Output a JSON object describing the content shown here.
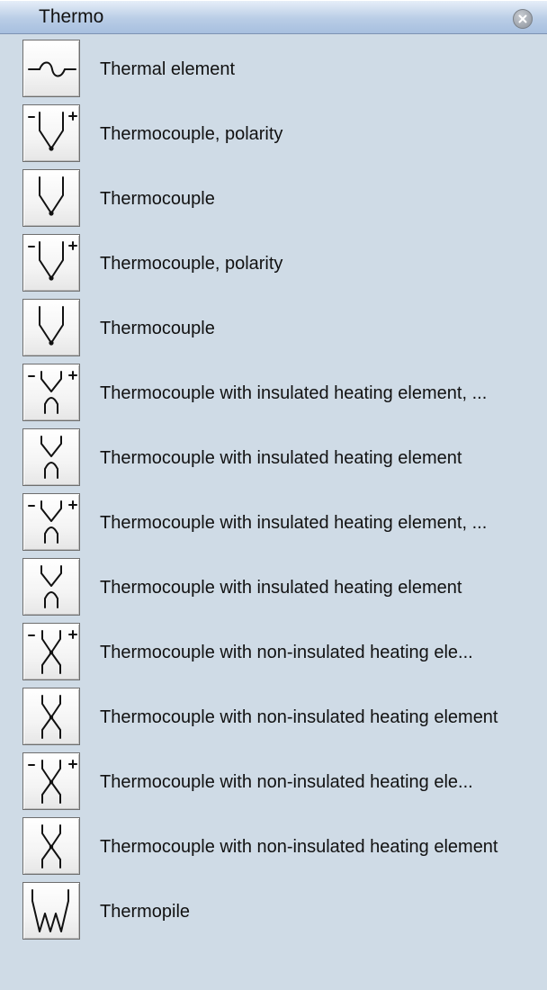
{
  "panel": {
    "title": "Thermo"
  },
  "items": [
    {
      "label": "Thermal element",
      "icon": "thermal-element-icon",
      "type": "thermal"
    },
    {
      "label": "Thermocouple, polarity",
      "icon": "thermocouple-polarity-icon",
      "type": "tc-pol-a"
    },
    {
      "label": "Thermocouple",
      "icon": "thermocouple-icon",
      "type": "tc-a"
    },
    {
      "label": "Thermocouple, polarity",
      "icon": "thermocouple-polarity-icon",
      "type": "tc-pol-b"
    },
    {
      "label": "Thermocouple",
      "icon": "thermocouple-icon",
      "type": "tc-b"
    },
    {
      "label": "Thermocouple with insulated heating element, ...",
      "icon": "thermocouple-insulated-polarity-icon",
      "type": "ins-pol"
    },
    {
      "label": "Thermocouple with insulated heating element",
      "icon": "thermocouple-insulated-icon",
      "type": "ins"
    },
    {
      "label": "Thermocouple with insulated heating element, ...",
      "icon": "thermocouple-insulated-polarity-icon",
      "type": "ins-pol"
    },
    {
      "label": "Thermocouple with insulated heating element",
      "icon": "thermocouple-insulated-icon",
      "type": "ins"
    },
    {
      "label": "Thermocouple with non-insulated heating ele...",
      "icon": "thermocouple-noninsulated-polarity-icon",
      "type": "non-pol"
    },
    {
      "label": "Thermocouple with non-insulated heating element",
      "icon": "thermocouple-noninsulated-icon",
      "type": "non"
    },
    {
      "label": "Thermocouple with non-insulated heating ele...",
      "icon": "thermocouple-noninsulated-polarity-icon",
      "type": "non-pol"
    },
    {
      "label": "Thermocouple with non-insulated heating element",
      "icon": "thermocouple-noninsulated-icon",
      "type": "non"
    },
    {
      "label": "Thermopile",
      "icon": "thermopile-icon",
      "type": "pile"
    }
  ]
}
